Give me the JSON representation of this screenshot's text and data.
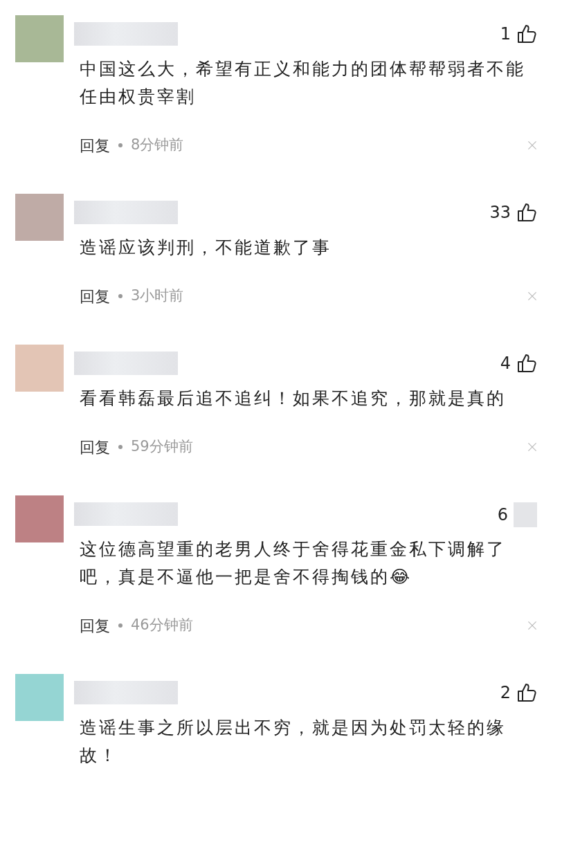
{
  "comments": [
    {
      "color": "#a8b896",
      "likes": "1",
      "kind": "thumb",
      "text": "中国这么大，希望有正义和能力的团体帮帮弱者不能任由权贵宰割",
      "reply": "回复",
      "time": "8分钟前"
    },
    {
      "color": "#bfaba6",
      "likes": "33",
      "kind": "thumb",
      "text": "造谣应该判刑，不能道歉了事",
      "reply": "回复",
      "time": "3小时前"
    },
    {
      "color": "#e3c5b5",
      "likes": "4",
      "kind": "thumb",
      "text": "看看韩磊最后追不追纠！如果不追究，那就是真的",
      "reply": "回复",
      "time": "59分钟前"
    },
    {
      "color": "#bd8184",
      "likes": "6",
      "kind": "blurred",
      "text": "这位德高望重的老男人终于舍得花重金私下调解了吧，真是不逼他一把是舍不得掏钱的😂",
      "reply": "回复",
      "time": "46分钟前"
    },
    {
      "color": "#95d5d3",
      "likes": "2",
      "kind": "thumb",
      "text": "造谣生事之所以层出不穷，就是因为处罚太轻的缘故！"
    }
  ]
}
